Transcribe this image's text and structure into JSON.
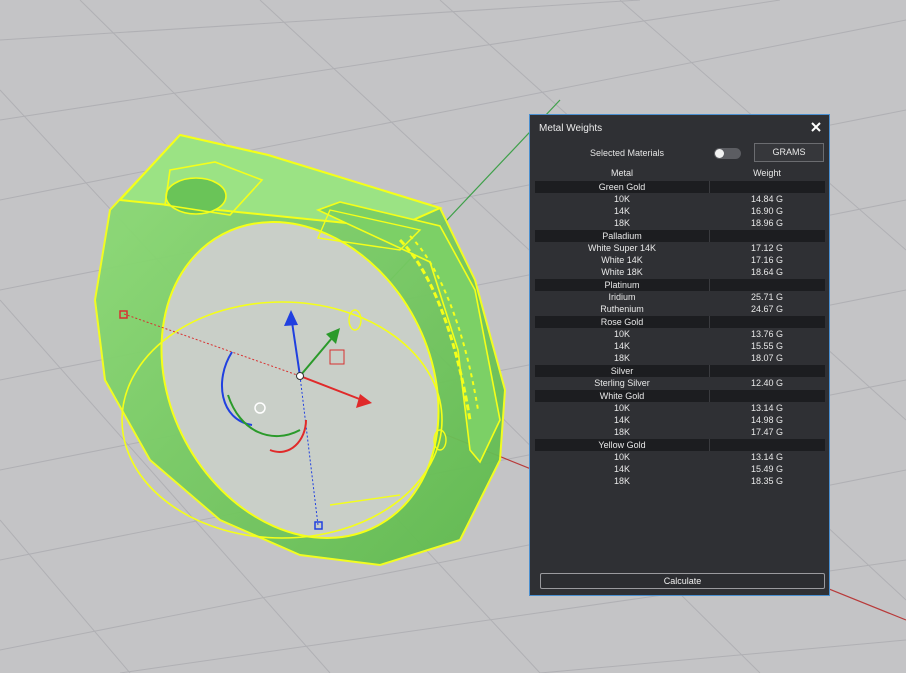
{
  "panel": {
    "title": "Metal Weights",
    "selected_materials_label": "Selected Materials",
    "selected_materials_on": false,
    "units_button": "GRAMS",
    "columns": {
      "metal": "Metal",
      "weight": "Weight"
    },
    "groups": [
      {
        "name": "Green Gold",
        "items": [
          {
            "metal": "10K",
            "weight": "14.84 G"
          },
          {
            "metal": "14K",
            "weight": "16.90 G"
          },
          {
            "metal": "18K",
            "weight": "18.96 G"
          }
        ]
      },
      {
        "name": "Palladium",
        "items": [
          {
            "metal": "White Super 14K",
            "weight": "17.12 G"
          },
          {
            "metal": "White 14K",
            "weight": "17.16 G"
          },
          {
            "metal": "White 18K",
            "weight": "18.64 G"
          }
        ]
      },
      {
        "name": "Platinum",
        "items": [
          {
            "metal": "Iridium",
            "weight": "25.71 G"
          },
          {
            "metal": "Ruthenium",
            "weight": "24.67 G"
          }
        ]
      },
      {
        "name": "Rose Gold",
        "items": [
          {
            "metal": "10K",
            "weight": "13.76 G"
          },
          {
            "metal": "14K",
            "weight": "15.55 G"
          },
          {
            "metal": "18K",
            "weight": "18.07 G"
          }
        ]
      },
      {
        "name": "Silver",
        "items": [
          {
            "metal": "Sterling Silver",
            "weight": "12.40 G"
          }
        ]
      },
      {
        "name": "White Gold",
        "items": [
          {
            "metal": "10K",
            "weight": "13.14 G"
          },
          {
            "metal": "14K",
            "weight": "14.98 G"
          },
          {
            "metal": "18K",
            "weight": "17.47 G"
          }
        ]
      },
      {
        "name": "Yellow Gold",
        "items": [
          {
            "metal": "10K",
            "weight": "13.14 G"
          },
          {
            "metal": "14K",
            "weight": "15.49 G"
          },
          {
            "metal": "18K",
            "weight": "18.35 G"
          }
        ]
      }
    ],
    "calculate_button": "Calculate"
  },
  "viewport": {
    "background_color": "#c4c4c6",
    "grid_color": "#aeaeb2",
    "x_axis_color": "#b83a3a",
    "y_axis_color": "#3fa04a",
    "selection_color": "#f4ff1a",
    "model_fill_color": "#7fd16a",
    "gumball": {
      "x_arrow_color": "#e02a2a",
      "y_arrow_color": "#2a9a2a",
      "z_arrow_color": "#2040e0"
    }
  }
}
